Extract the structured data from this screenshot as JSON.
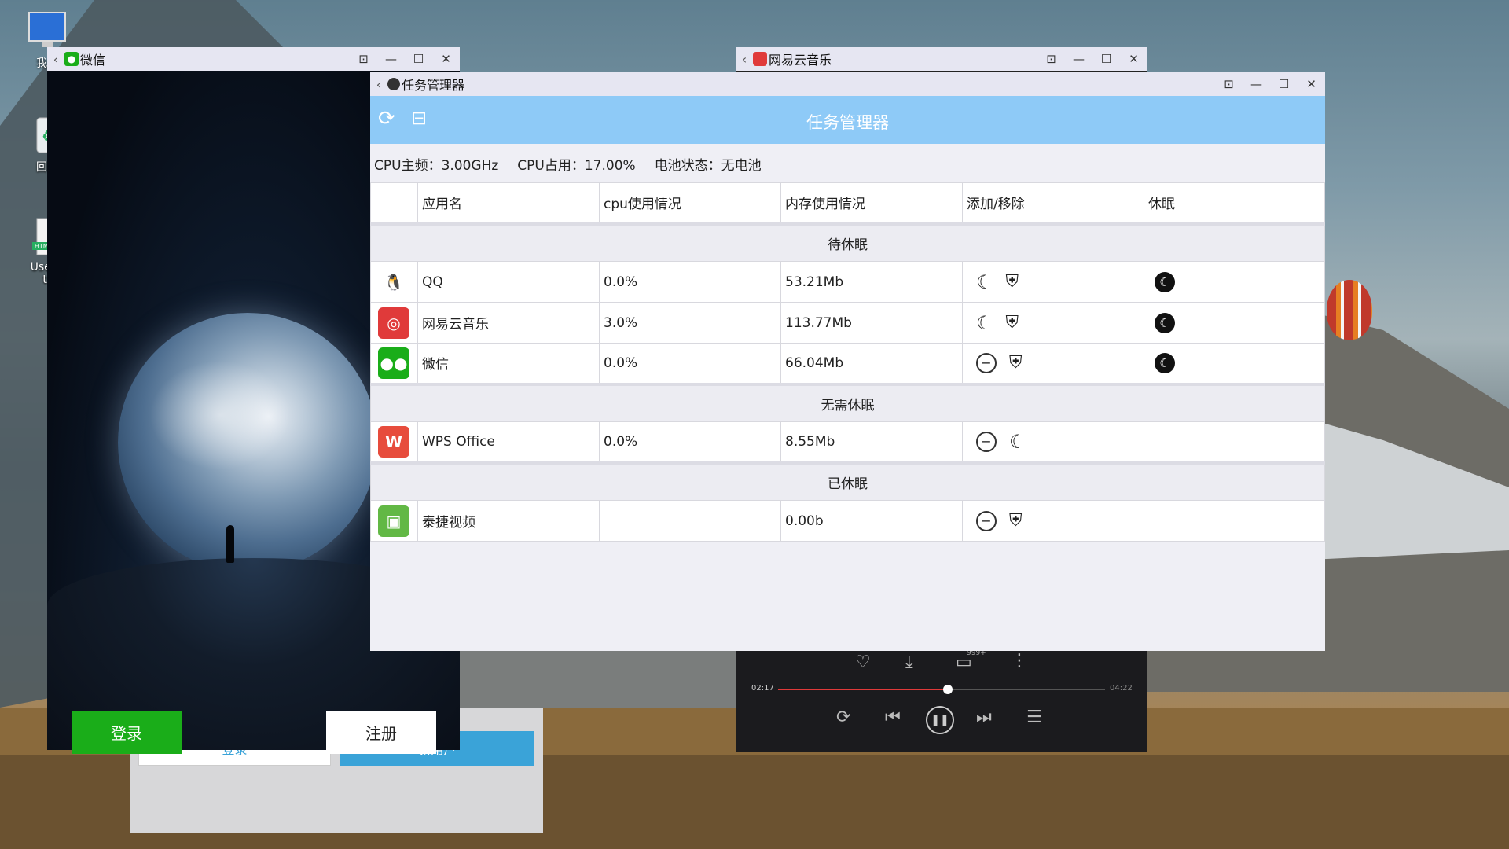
{
  "desktop": {
    "icons": [
      {
        "label": "我的",
        "icon": "computer-icon"
      },
      {
        "label": "回收",
        "icon": "recycle-bin-icon"
      },
      {
        "label": "UserG",
        "sublabel": "tr",
        "icon": "html-file-icon"
      }
    ]
  },
  "wechat_window": {
    "title": "微信",
    "login_label": "登录",
    "register_label": "注册",
    "colors": {
      "login": "#1aad19",
      "register": "#ffffff"
    }
  },
  "background_window": {
    "login_label": "登录",
    "register_label": "新用户"
  },
  "music_window": {
    "title": "网易云音乐",
    "comment_badge": "999+",
    "time_current": "02:17",
    "time_total": "04:22",
    "progress": 0.52,
    "accent": "#e03a3a"
  },
  "task_manager": {
    "window_title": "任务管理器",
    "header_title": "任务管理器",
    "header_color": "#8ecaf7",
    "info": {
      "cpu_freq": "CPU主频：3.00GHz",
      "cpu_usage": "CPU占用：17.00%",
      "battery": "电池状态：无电池"
    },
    "columns": [
      "应用名",
      "cpu使用情况",
      "内存使用情况",
      "添加/移除",
      "休眠"
    ],
    "sections": [
      {
        "title": "待休眠",
        "rows": [
          {
            "name": "QQ",
            "cpu": "0.0%",
            "mem": "53.21Mb",
            "actions": [
              "moon-icon",
              "shield-icon"
            ],
            "sleep": true,
            "icon": "qq-icon"
          },
          {
            "name": "网易云音乐",
            "cpu": "3.0%",
            "mem": "113.77Mb",
            "actions": [
              "moon-icon",
              "shield-icon"
            ],
            "sleep": true,
            "icon": "netease-music-icon"
          },
          {
            "name": "微信",
            "cpu": "0.0%",
            "mem": "66.04Mb",
            "actions": [
              "minus-circle-icon",
              "shield-icon"
            ],
            "sleep": true,
            "icon": "wechat-icon"
          }
        ]
      },
      {
        "title": "无需休眠",
        "rows": [
          {
            "name": "WPS Office",
            "cpu": "0.0%",
            "mem": "8.55Mb",
            "actions": [
              "minus-circle-icon",
              "moon-icon"
            ],
            "sleep": false,
            "icon": "wps-icon"
          }
        ]
      },
      {
        "title": "已休眠",
        "rows": [
          {
            "name": "泰捷视频",
            "cpu": "",
            "mem": "0.00b",
            "actions": [
              "minus-circle-icon",
              "shield-icon"
            ],
            "sleep": false,
            "icon": "taijie-video-icon"
          }
        ]
      }
    ]
  }
}
